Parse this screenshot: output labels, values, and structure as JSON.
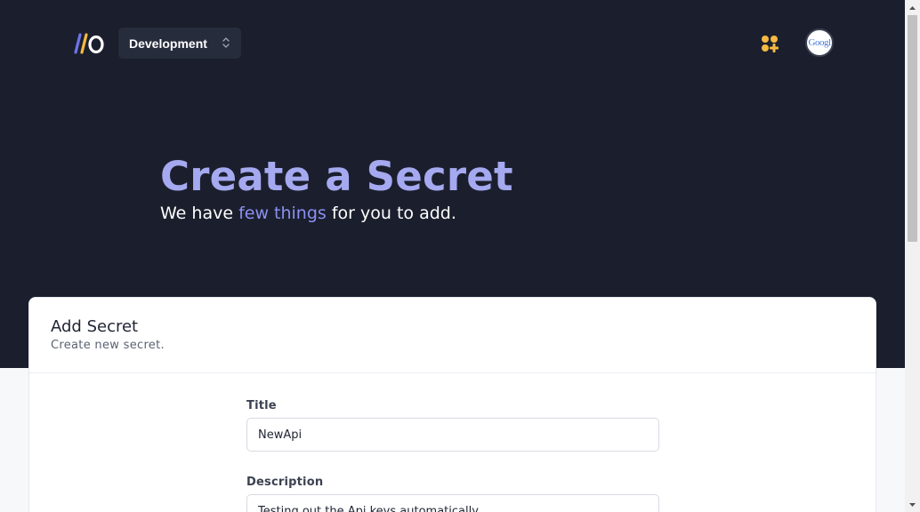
{
  "nav": {
    "environment_label": "Development",
    "avatar_text": "Googl",
    "colors": {
      "nav_bg": "#1b1f2d",
      "env_bg": "#272c3c",
      "apps_icon": "#f5b942"
    }
  },
  "hero": {
    "title": "Create a Secret",
    "subtitle_before": "We have ",
    "subtitle_highlight": "few things",
    "subtitle_after": " for you to add.",
    "colors": {
      "title": "#a5a9f0",
      "highlight": "#8b90f2"
    }
  },
  "card": {
    "title": "Add Secret",
    "description": "Create new secret.",
    "fields": {
      "title": {
        "label": "Title",
        "value": "NewApi"
      },
      "description": {
        "label": "Description",
        "value": "Testing out the Api keys automatically"
      }
    }
  },
  "icons": {
    "logo": "logo-icon",
    "chevron": "chevron-up-down-icon",
    "apps": "apps-plus-icon",
    "avatar": "google-avatar-icon"
  }
}
